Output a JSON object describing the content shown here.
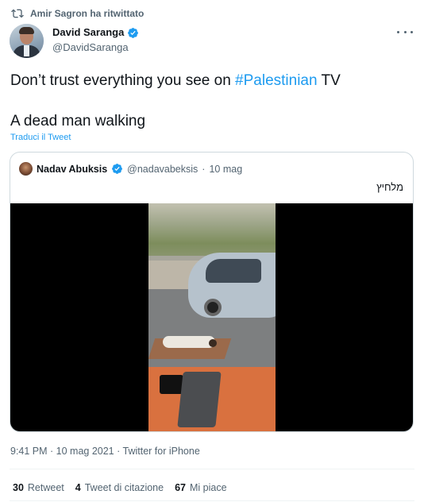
{
  "retweet_context": {
    "icon": "retweet-icon",
    "text": "Amir Sagron ha ritwittato"
  },
  "author": {
    "name": "David Saranga",
    "handle": "@DavidSaranga",
    "verified_icon": "verified-badge-icon"
  },
  "tweet": {
    "text_before": "Don’t trust everything you see on ",
    "hashtag": "#Palestinian",
    "text_after": " TV",
    "line2": "A dead man walking",
    "translate_label": "Traduci il Tweet"
  },
  "quoted_tweet": {
    "name": "Nadav Abuksis",
    "handle": "@nadavabeksis",
    "separator": "·",
    "date": "10 mag",
    "text": "מלחיץ"
  },
  "meta": {
    "text": "9:41 PM · 10 mag 2021 · Twitter for iPhone"
  },
  "stats": {
    "retweets_count": "30",
    "retweets_label": "Retweet",
    "quotes_count": "4",
    "quotes_label": "Tweet di citazione",
    "likes_count": "67",
    "likes_label": "Mi piace"
  },
  "colors": {
    "accent": "#1d9bf0",
    "text": "#0f1419",
    "secondary": "#536471",
    "border": "#cfd9de"
  }
}
